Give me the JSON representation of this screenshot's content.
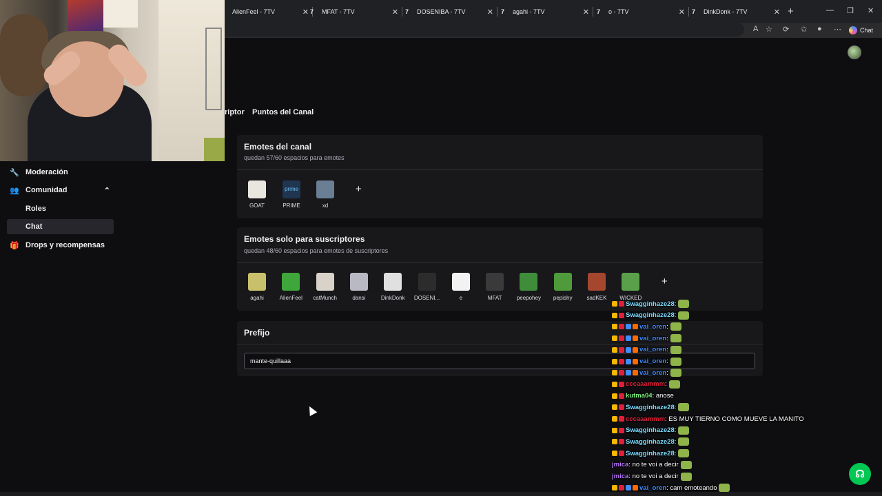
{
  "browser": {
    "tabs": [
      {
        "title": "AlienFeel - 7TV"
      },
      {
        "title": "MFAT - 7TV"
      },
      {
        "title": "DOSENIBA - 7TV"
      },
      {
        "title": "agahi - 7TV"
      },
      {
        "title": "o - 7TV"
      },
      {
        "title": "DinkDonk - 7TV"
      }
    ],
    "tab_icon": "7TV",
    "new_tab": "+",
    "chat_button": "Chat"
  },
  "sidebar": {
    "items": [
      {
        "label": "Moderación",
        "icon": "wrench-icon"
      },
      {
        "label": "Comunidad",
        "icon": "people-icon"
      },
      {
        "label": "Roles"
      },
      {
        "label": "Chat"
      },
      {
        "label": "Drops y recompensas",
        "icon": "gift-icon"
      }
    ]
  },
  "subtabs": [
    "riptor",
    "Puntos del Canal"
  ],
  "channel_emotes": {
    "title": "Emotes del canal",
    "subtitle": "quedan 57/60 espacios para emotes",
    "emotes": [
      {
        "label": "GOAT",
        "color": "#e9e6df"
      },
      {
        "label": "PRIME",
        "color": "#1f3550"
      },
      {
        "label": "xd",
        "color": "#6a7f94"
      }
    ],
    "add": "+"
  },
  "sub_emotes": {
    "title": "Emotes solo para suscriptores",
    "subtitle": "quedan 48/60 espacios para emotes de suscriptores",
    "emotes": [
      {
        "label": "agahi",
        "color": "#c9c06b"
      },
      {
        "label": "AlienFeel",
        "color": "#3fa63c"
      },
      {
        "label": "catMunch",
        "color": "#d9d2c8"
      },
      {
        "label": "dansi",
        "color": "#b9b9c4"
      },
      {
        "label": "DinkDonk",
        "color": "#e0e0e0"
      },
      {
        "label": "DOSENI...",
        "color": "#2c2c2c"
      },
      {
        "label": "e",
        "color": "#f2f2f2"
      },
      {
        "label": "MFAT",
        "color": "#3a3a3a"
      },
      {
        "label": "peepohey",
        "color": "#3f8d3a"
      },
      {
        "label": "pepishy",
        "color": "#4f9a3b"
      },
      {
        "label": "sadKEK",
        "color": "#a5462e"
      },
      {
        "label": "WICKED",
        "color": "#5aa04a"
      }
    ],
    "add": "+"
  },
  "prefix": {
    "title": "Prefijo",
    "value": "mante-quillaaa"
  },
  "chat": {
    "messages": [
      {
        "user": "Swagginhaze28",
        "text": ":",
        "color": "#7cdcff"
      },
      {
        "user": "Swagginhaze28",
        "text": ":",
        "color": "#7cdcff"
      },
      {
        "user": "vai_oren",
        "text": ":",
        "color": "#3f8cff"
      },
      {
        "user": "vai_oren",
        "text": ":",
        "color": "#3f8cff"
      },
      {
        "user": "vai_oren",
        "text": ":",
        "color": "#3f8cff"
      },
      {
        "user": "vai_oren",
        "text": ":",
        "color": "#3f8cff"
      },
      {
        "user": "vai_oren",
        "text": ":",
        "color": "#3f8cff"
      },
      {
        "user": "cccaaammm",
        "text": ":",
        "color": "#e0203b"
      },
      {
        "user": "kutma04",
        "text": ": anose",
        "color": "#7cf27c"
      },
      {
        "user": "Swagginhaze28",
        "text": ":",
        "color": "#7cdcff"
      },
      {
        "user": "cccaaammm",
        "text": ": ES MUY TIERNO COMO MUEVE LA MANITO",
        "color": "#e0203b"
      },
      {
        "user": "Swagginhaze28",
        "text": ":",
        "color": "#7cdcff"
      },
      {
        "user": "Swagginhaze28",
        "text": ":",
        "color": "#7cdcff"
      },
      {
        "user": "Swagginhaze28",
        "text": ":",
        "color": "#7cdcff"
      },
      {
        "user": "jmica",
        "text": ": no te voi a decir",
        "color": "#b676f7"
      },
      {
        "user": "jmica",
        "text": ": no te voi a decir",
        "color": "#b676f7"
      },
      {
        "user": "vai_oren",
        "text": ": cam emoteando",
        "color": "#3f8cff"
      }
    ]
  }
}
